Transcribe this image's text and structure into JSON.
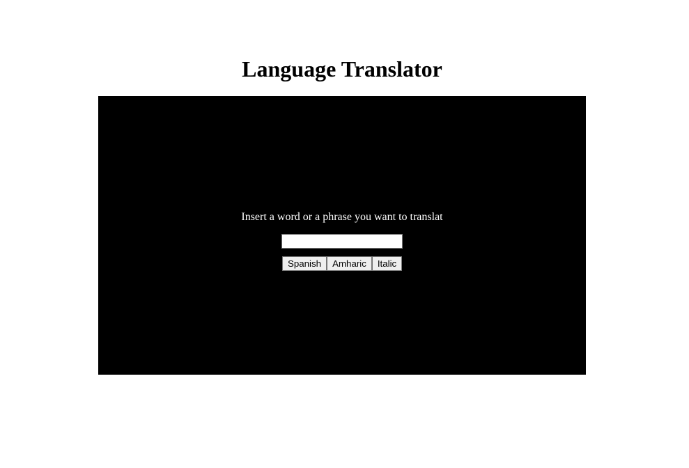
{
  "header": {
    "title": "Language Translator"
  },
  "translator": {
    "prompt": "Insert a word or a phrase you want to translat",
    "input_value": "",
    "input_placeholder": "",
    "buttons": [
      {
        "label": "Spanish"
      },
      {
        "label": "Amharic"
      },
      {
        "label": "Italic"
      }
    ]
  },
  "colors": {
    "page_background": "#ffffff",
    "panel_background": "#000000",
    "prompt_text": "#ffffff",
    "button_background": "#efefef"
  }
}
